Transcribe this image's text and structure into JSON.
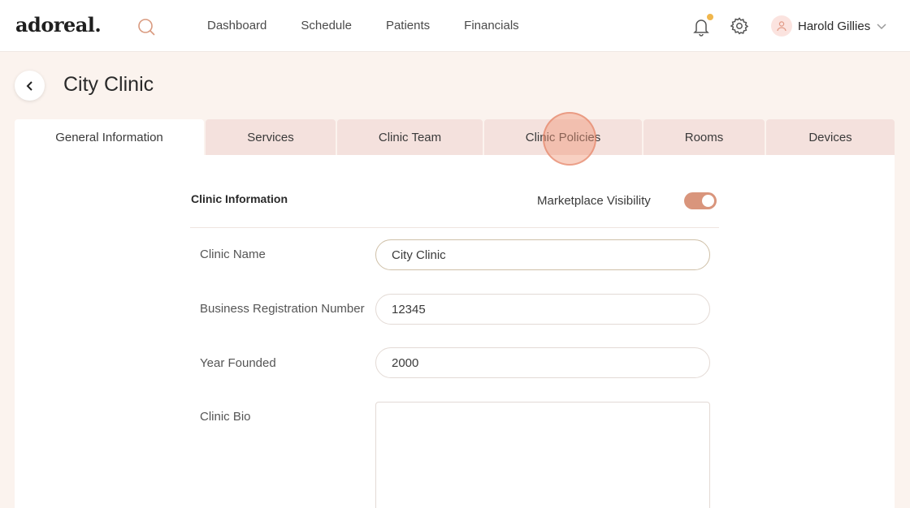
{
  "brand": {
    "logo": "adoreal."
  },
  "nav": {
    "items": [
      {
        "label": "Dashboard"
      },
      {
        "label": "Schedule"
      },
      {
        "label": "Patients"
      },
      {
        "label": "Financials"
      }
    ]
  },
  "user": {
    "name": "Harold Gillies"
  },
  "page": {
    "title": "City Clinic"
  },
  "tabs": [
    {
      "label": "General Information",
      "active": true
    },
    {
      "label": "Services"
    },
    {
      "label": "Clinic Team"
    },
    {
      "label": "Clinic Policies"
    },
    {
      "label": "Rooms"
    },
    {
      "label": "Devices"
    }
  ],
  "section": {
    "title": "Clinic Information",
    "marketplace_label": "Marketplace Visibility",
    "marketplace_on": true
  },
  "fields": {
    "clinic_name": {
      "label": "Clinic Name",
      "value": "City Clinic"
    },
    "reg_number": {
      "label": "Business Registration Number",
      "value": "12345"
    },
    "year_founded": {
      "label": "Year Founded",
      "value": "2000"
    },
    "bio": {
      "label": "Clinic Bio",
      "value": ""
    }
  },
  "colors": {
    "accent": "#d9957c",
    "tab_bg": "#f4e1dd",
    "page_bg": "#fbf3ee",
    "notification_dot": "#f0b64c"
  },
  "icons": {
    "search": "search-icon",
    "bell": "bell-icon",
    "gear": "gear-icon",
    "user": "user-icon",
    "chevron": "chevron-down-icon",
    "back": "chevron-left-icon"
  }
}
